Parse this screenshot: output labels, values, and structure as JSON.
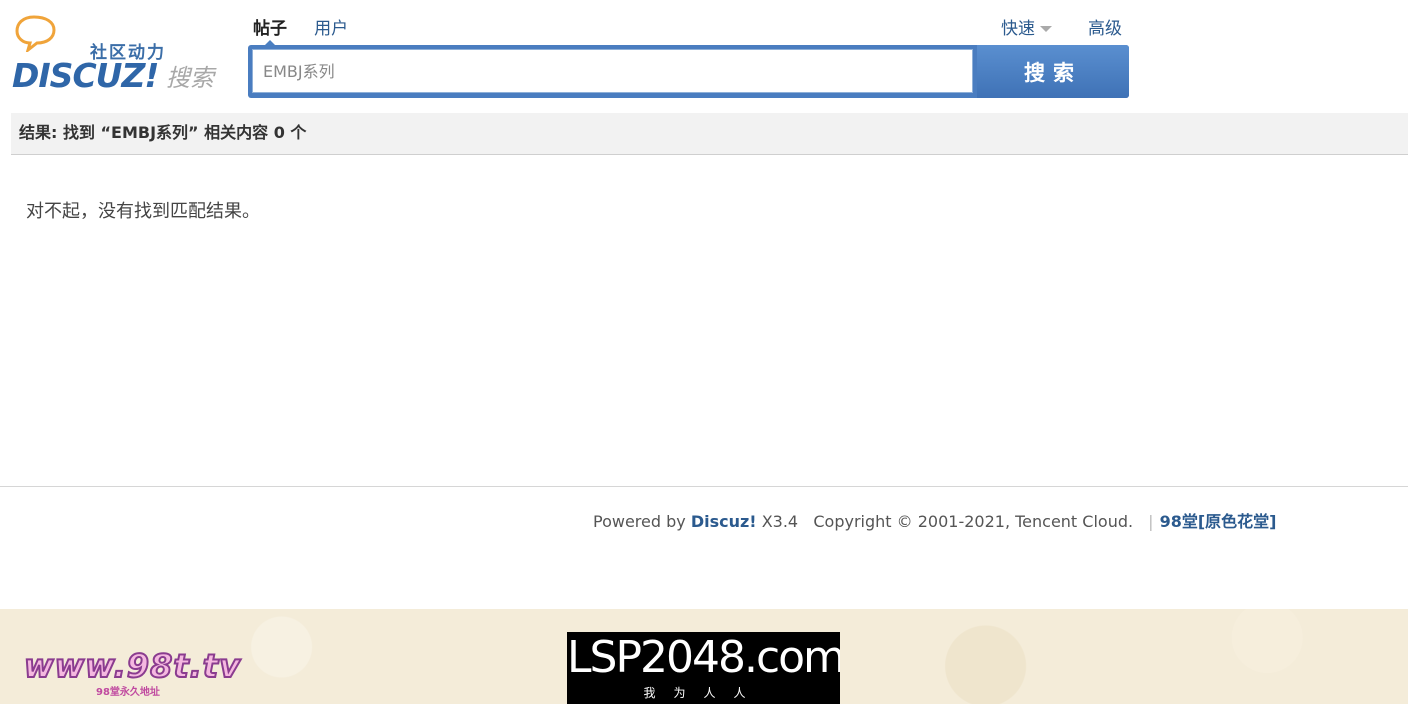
{
  "logo": {
    "tagline": "社区动力",
    "brand": "DISCUZ!",
    "sub": "搜索"
  },
  "tabs": [
    {
      "label": "帖子",
      "active": true
    },
    {
      "label": "用户",
      "active": false
    }
  ],
  "header": {
    "quick_label": "快速",
    "advanced_label": "高级"
  },
  "search": {
    "value": "",
    "placeholder": "EMBJ系列",
    "button_label": "搜索"
  },
  "results": {
    "summary": "结果: 找到 “EMBJ系列” 相关内容 0 个",
    "empty_message": "对不起，没有找到匹配结果。"
  },
  "footer": {
    "powered_by": "Powered by",
    "product": "Discuz!",
    "version": "X3.4",
    "copyright": "Copyright © 2001-2021, Tencent Cloud.",
    "separator": "|",
    "site_name": "98堂[原色花堂]"
  },
  "banner": {
    "left_text": "www.98t.tv",
    "left_sub": "98堂永久地址",
    "right_text": "LSP2048.com",
    "right_sub": "我为人人"
  },
  "colors": {
    "link": "#2b5a8e",
    "search_blue": "#4a7dc0",
    "result_bar_bg": "#f2f2f2"
  }
}
